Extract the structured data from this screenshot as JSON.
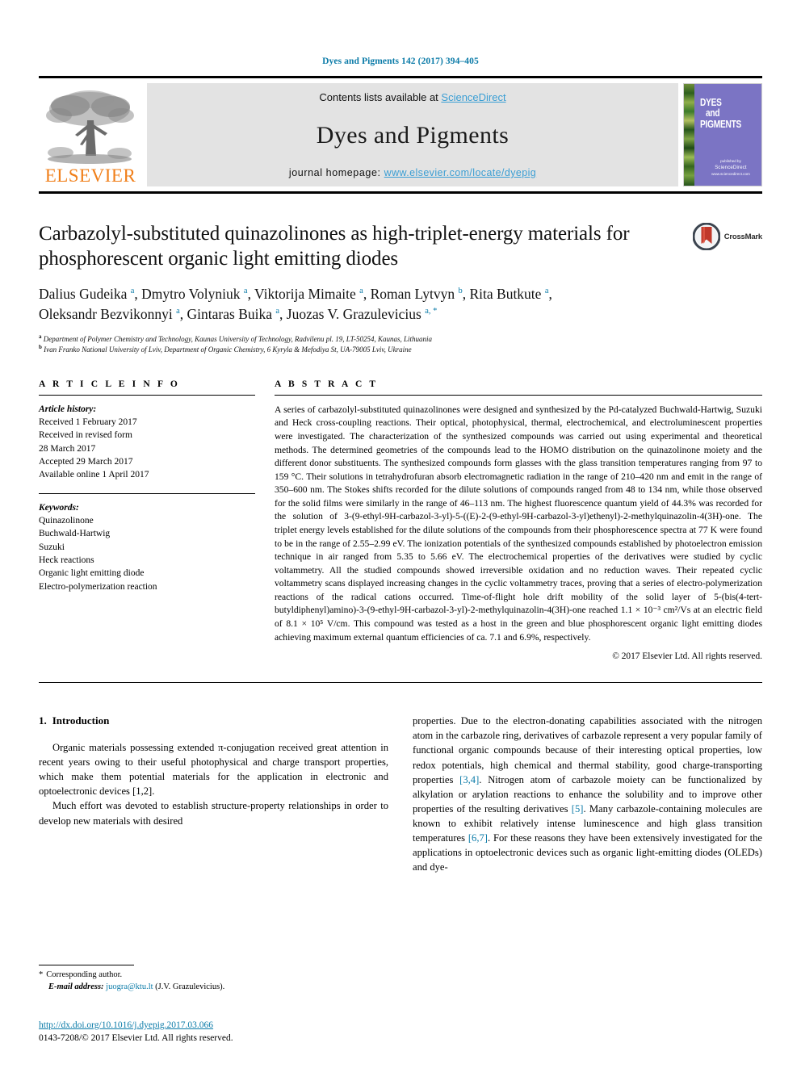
{
  "running_head": "Dyes and Pigments 142 (2017) 394–405",
  "masthead": {
    "publisher": "ELSEVIER",
    "contents_prefix": "Contents lists available at ",
    "contents_link": "ScienceDirect",
    "journal_title": "Dyes and Pigments",
    "homepage_label": "journal homepage: ",
    "homepage_url": "www.elsevier.com/locate/dyepig",
    "cover": {
      "line1": "DYES",
      "line2": "and",
      "line3": "PIGMENTS",
      "footer_small": "published by",
      "footer_mark": "ScienceDirect",
      "footer_tiny": "www.sciencedirect.com"
    }
  },
  "article": {
    "title": "Carbazolyl-substituted quinazolinones as high-triplet-energy materials for phosphorescent organic light emitting diodes",
    "crossmark_label": "CrossMark",
    "authors_line1": "Dalius Gudeika <sup>a</sup>, Dmytro Volyniuk <sup>a</sup>, Viktorija Mimaite <sup>a</sup>, Roman Lytvyn <sup>b</sup>, Rita Butkute <sup>a</sup>,",
    "authors_line2": "Oleksandr Bezvikonnyi <sup>a</sup>, Gintaras Buika <sup>a</sup>, Juozas V. Grazulevicius <sup>a, *</sup>",
    "affiliation_a": "Department of Polymer Chemistry and Technology, Kaunas University of Technology, Radvilenu pl. 19, LT-50254, Kaunas, Lithuania",
    "affiliation_b": "Ivan Franko National University of Lviv, Department of Organic Chemistry, 6 Kyryla & Mefodiya St, UA-79005 Lviv, Ukraine"
  },
  "article_info": {
    "heading": "A R T I C L E   I N F O",
    "history_label": "Article history:",
    "history": [
      "Received 1 February 2017",
      "Received in revised form",
      "28 March 2017",
      "Accepted 29 March 2017",
      "Available online 1 April 2017"
    ],
    "keywords_label": "Keywords:",
    "keywords": [
      "Quinazolinone",
      "Buchwald-Hartwig",
      "Suzuki",
      "Heck reactions",
      "Organic light emitting diode",
      "Electro-polymerization reaction"
    ]
  },
  "abstract": {
    "heading": "A B S T R A C T",
    "text": "A series of carbazolyl-substituted quinazolinones were designed and synthesized by the Pd-catalyzed Buchwald-Hartwig, Suzuki and Heck cross-coupling reactions. Their optical, photophysical, thermal, electrochemical, and electroluminescent properties were investigated. The characterization of the synthesized compounds was carried out using experimental and theoretical methods. The determined geometries of the compounds lead to the HOMO distribution on the quinazolinone moiety and the different donor substituents. The synthesized compounds form glasses with the glass transition temperatures ranging from 97 to 159 °C. Their solutions in tetrahydrofuran absorb electromagnetic radiation in the range of 210–420 nm and emit in the range of 350–600 nm. The Stokes shifts recorded for the dilute solutions of compounds ranged from 48 to 134 nm, while those observed for the solid films were similarly in the range of 46–113 nm. The highest fluorescence quantum yield of 44.3% was recorded for the solution of 3-(9-ethyl-9H-carbazol-3-yl)-5-((E)-2-(9-ethyl-9H-carbazol-3-yl)ethenyl)-2-methylquinazolin-4(3H)-one. The triplet energy levels established for the dilute solutions of the compounds from their phosphorescence spectra at 77 K were found to be in the range of 2.55–2.99 eV. The ionization potentials of the synthesized compounds established by photoelectron emission technique in air ranged from 5.35 to 5.66 eV. The electrochemical properties of the derivatives were studied by cyclic voltammetry. All the studied compounds showed irreversible oxidation and no reduction waves. Their repeated cyclic voltammetry scans displayed increasing changes in the cyclic voltammetry traces, proving that a series of electro-polymerization reactions of the radical cations occurred. Time-of-flight hole drift mobility of the solid layer of 5-(bis(4-tert-butyldiphenyl)amino)-3-(9-ethyl-9H-carbazol-3-yl)-2-methylquinazolin-4(3H)-one reached 1.1 × 10⁻³ cm²/Vs at an electric field of 8.1 × 10⁵ V/cm. This compound was tested as a host in the green and blue phosphorescent organic light emitting diodes achieving maximum external quantum efficiencies of ca. 7.1 and 6.9%, respectively.",
    "copyright": "© 2017 Elsevier Ltd. All rights reserved."
  },
  "introduction": {
    "number": "1.",
    "title": "Introduction",
    "left_p1": "Organic materials possessing extended π-conjugation received great attention in recent years owing to their useful photophysical and charge transport properties, which make them potential materials for the application in electronic and optoelectronic devices [1,2].",
    "left_p1_ref": "[1,2]",
    "left_p2": "Much effort was devoted to establish structure-property relationships in order to develop new materials with desired",
    "right_p1_a": "properties. Due to the electron-donating capabilities associated with the nitrogen atom in the carbazole ring, derivatives of carbazole represent a very popular family of functional organic compounds because of their interesting optical properties, low redox potentials, high chemical and thermal stability, good charge-transporting properties ",
    "right_ref1": "[3,4]",
    "right_p1_b": ". Nitrogen atom of carbazole moiety can be functionalized by alkylation or arylation reactions to enhance the solubility and to improve other properties of the resulting derivatives ",
    "right_ref2": "[5]",
    "right_p1_c": ". Many carbazole-containing molecules are known to exhibit relatively intense luminescence and high glass transition temperatures ",
    "right_ref3": "[6,7]",
    "right_p1_d": ". For these reasons they have been extensively investigated for the applications in optoelectronic devices such as organic light-emitting diodes (OLEDs) and dye-"
  },
  "footnote": {
    "star": "*",
    "corresponding": "Corresponding author.",
    "email_label": "E-mail address:",
    "email": "juogra@ktu.lt",
    "email_suffix": "(J.V. Grazulevicius)."
  },
  "footer": {
    "doi": "http://dx.doi.org/10.1016/j.dyepig.2017.03.066",
    "issn_line": "0143-7208/© 2017 Elsevier Ltd. All rights reserved."
  },
  "colors": {
    "link_blue": "#0b7ba8",
    "sciencedirect_blue": "#3a9ed4",
    "elsevier_orange": "#f07f1a",
    "cover_purple": "#7b74c4",
    "banner_gray": "#e3e3e3"
  }
}
